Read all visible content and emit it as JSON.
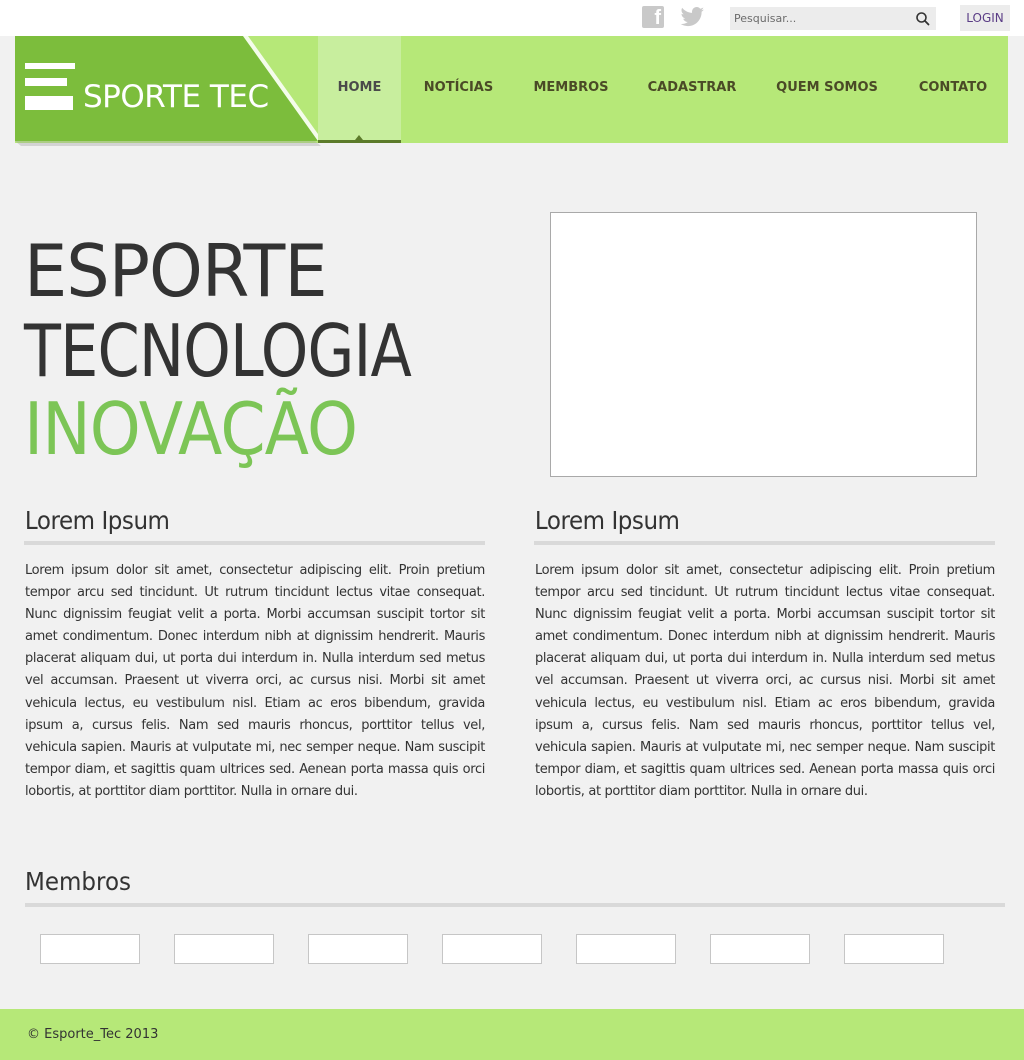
{
  "topbar": {
    "social": [
      {
        "name": "facebook-icon",
        "glyph": "f",
        "color": "#c9c9c9"
      },
      {
        "name": "twitter-icon",
        "color": "#c9c9c9"
      }
    ],
    "search": {
      "placeholder": "Pesquisar...",
      "value": ""
    },
    "login_label": "LOGIN"
  },
  "header": {
    "logo_text": "SPORTE TEC",
    "logo_color": "#7cbd3c",
    "nav": [
      {
        "label": "HOME",
        "active": true
      },
      {
        "label": "NOTÍCIAS",
        "active": false
      },
      {
        "label": "MEMBROS",
        "active": false
      },
      {
        "label": "CADASTRAR",
        "active": false
      },
      {
        "label": "QUEM SOMOS",
        "active": false
      },
      {
        "label": "CONTATO",
        "active": false
      }
    ]
  },
  "hero": {
    "line1": "ESPORTE",
    "line2": "TECNOLOGIA",
    "line3": "INOVAÇÃO",
    "accent_color": "#7cc556"
  },
  "columns": [
    {
      "title": "Lorem Ipsum",
      "text": "Lorem ipsum dolor sit amet, consectetur adipiscing elit. Proin pretium tempor arcu sed tincidunt. Ut rutrum tincidunt lectus vitae consequat. Nunc dignissim feugiat velit a porta. Morbi accumsan suscipit tortor sit amet condimentum. Donec interdum nibh at dignissim hendrerit. Mauris placerat aliquam dui, ut porta dui interdum in. Nulla interdum sed metus vel accumsan. Praesent ut viverra orci, ac cursus nisi. Morbi sit amet vehicula lectus, eu vestibulum nisl. Etiam ac eros bibendum, gravida ipsum a, cursus felis. Nam sed mauris rhoncus, porttitor tellus vel, vehicula sapien. Mauris at vulputate mi, nec semper neque. Nam suscipit tempor diam, et sagittis quam ultrices sed. Aenean porta massa quis orci lobortis, at porttitor diam porttitor. Nulla in ornare dui."
    },
    {
      "title": "Lorem Ipsum",
      "text": "Lorem ipsum dolor sit amet, consectetur adipiscing elit. Proin pretium tempor arcu sed tincidunt. Ut rutrum tincidunt lectus vitae consequat. Nunc dignissim feugiat velit a porta. Morbi accumsan suscipit tortor sit amet condimentum. Donec interdum nibh at dignissim hendrerit. Mauris placerat aliquam dui, ut porta dui interdum in. Nulla interdum sed metus vel accumsan. Praesent ut viverra orci, ac cursus nisi. Morbi sit amet vehicula lectus, eu vestibulum nisl. Etiam ac eros bibendum, gravida ipsum a, cursus felis. Nam sed mauris rhoncus, porttitor tellus vel, vehicula sapien. Mauris at vulputate mi, nec semper neque. Nam suscipit tempor diam, et sagittis quam ultrices sed. Aenean porta massa quis orci lobortis, at porttitor diam porttitor. Nulla in ornare dui."
    }
  ],
  "members": {
    "title": "Membros",
    "count": 7
  },
  "footer": {
    "copyright": "© Esporte_Tec 2013",
    "color": "#b6e878"
  }
}
